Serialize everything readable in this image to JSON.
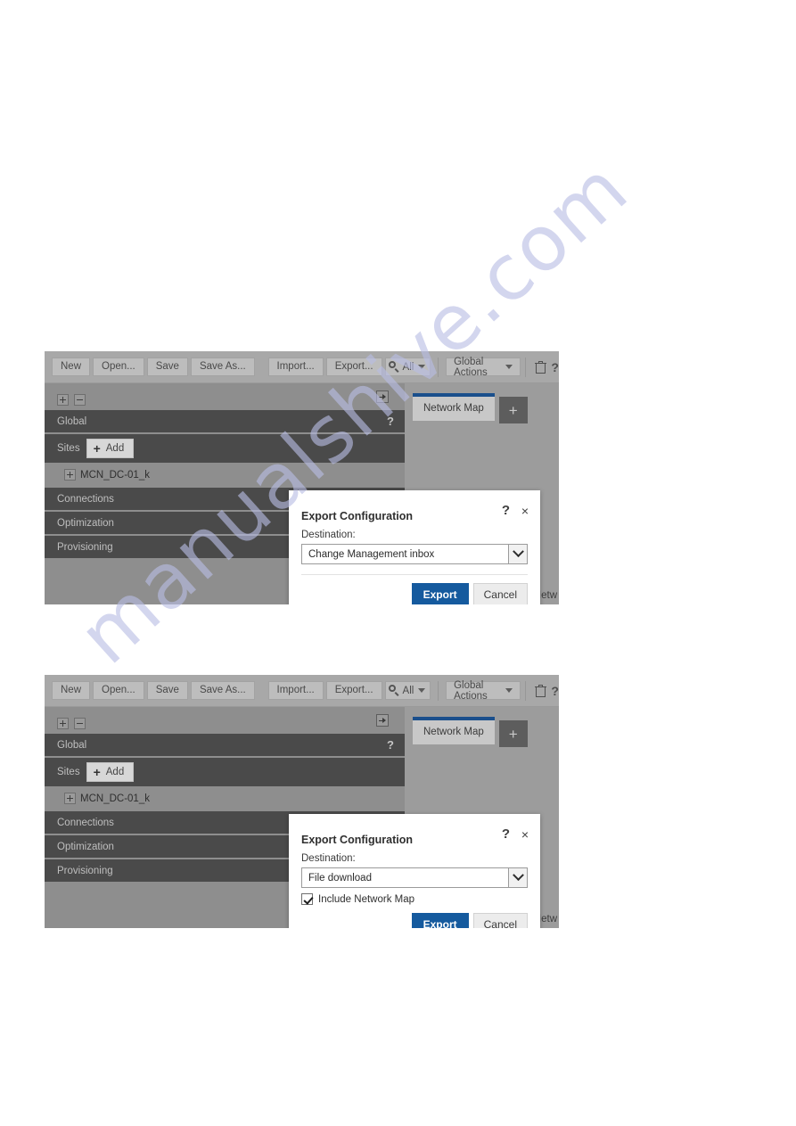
{
  "watermark": {
    "text": "manualshive.com"
  },
  "screenshots": [
    {
      "toolbar": {
        "new_label": "New",
        "open_label": "Open...",
        "save_label": "Save",
        "save_as_label": "Save As...",
        "import_label": "Import...",
        "export_label": "Export...",
        "search_label": "All",
        "global_actions_label": "Global Actions",
        "delete_icon": "trash-icon",
        "help_label": "?"
      },
      "tree": {
        "expand_all_icon": "plus-box-icon",
        "collapse_all_icon": "minus-box-icon",
        "collapse_panel_icon": "collapse-right-icon",
        "global_label": "Global",
        "global_help": "?",
        "sites_label": "Sites",
        "add_label": "Add",
        "site_name": "MCN_DC-01_k",
        "connections_label": "Connections",
        "optimization_label": "Optimization",
        "provisioning_label": "Provisioning"
      },
      "tabs": {
        "active_label": "Network Map",
        "add_tab_label": "+"
      },
      "footnote": "This Netw",
      "dialog": {
        "title": "Export Configuration",
        "help_label": "?",
        "close_label": "×",
        "destination_label": "Destination:",
        "destination_value": "Change Management inbox",
        "has_checkbox": false,
        "checkbox_label": "",
        "export_label": "Export",
        "cancel_label": "Cancel"
      }
    },
    {
      "toolbar": {
        "new_label": "New",
        "open_label": "Open...",
        "save_label": "Save",
        "save_as_label": "Save As...",
        "import_label": "Import...",
        "export_label": "Export...",
        "search_label": "All",
        "global_actions_label": "Global Actions",
        "delete_icon": "trash-icon",
        "help_label": "?"
      },
      "tree": {
        "expand_all_icon": "plus-box-icon",
        "collapse_all_icon": "minus-box-icon",
        "collapse_panel_icon": "collapse-right-icon",
        "global_label": "Global",
        "global_help": "?",
        "sites_label": "Sites",
        "add_label": "Add",
        "site_name": "MCN_DC-01_k",
        "connections_label": "Connections",
        "optimization_label": "Optimization",
        "provisioning_label": "Provisioning"
      },
      "tabs": {
        "active_label": "Network Map",
        "add_tab_label": "+"
      },
      "footnote": "This Netw",
      "dialog": {
        "title": "Export Configuration",
        "help_label": "?",
        "close_label": "×",
        "destination_label": "Destination:",
        "destination_value": "File download",
        "has_checkbox": true,
        "checkbox_label": "Include Network Map",
        "export_label": "Export",
        "cancel_label": "Cancel"
      }
    }
  ],
  "colors": {
    "accent_blue": "#155a9e",
    "tab_accent": "#1a4f8c",
    "panel_gray": "#8e8e8e",
    "toolbar_gray": "#a8a8a8",
    "row_dark": "#4a4a4a",
    "watermark": "#b9bde4"
  }
}
